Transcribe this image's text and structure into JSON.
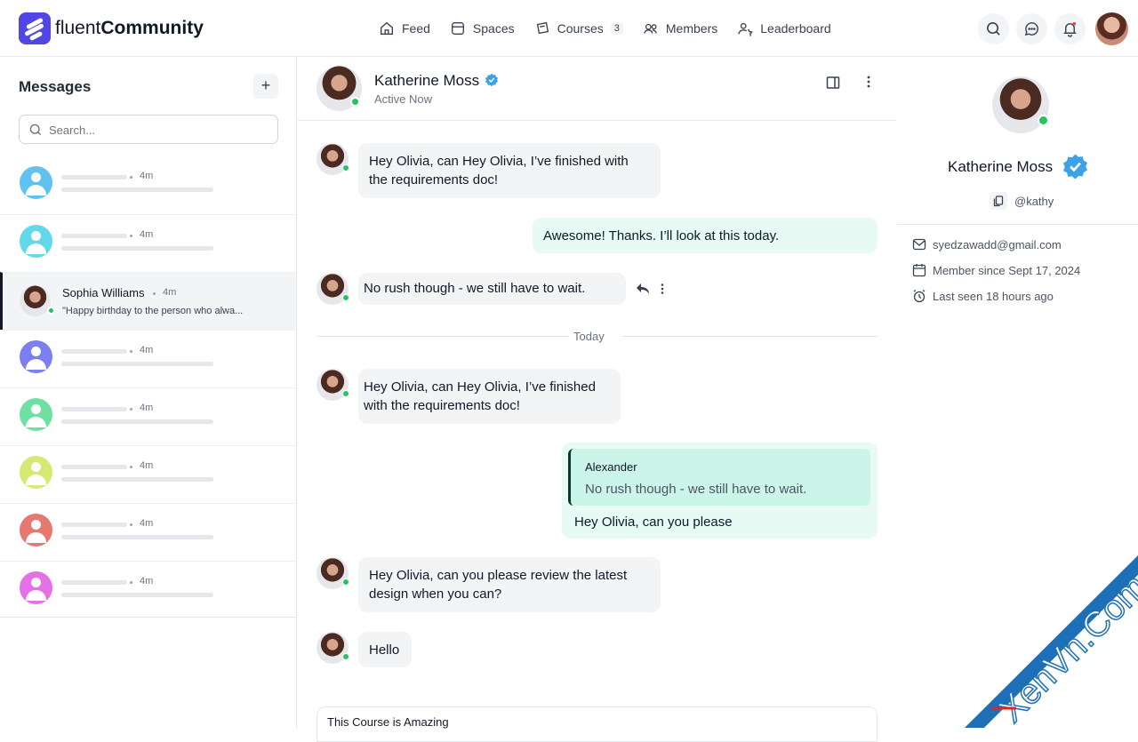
{
  "brand": {
    "name_light": "fluent",
    "name_bold": "Community"
  },
  "nav": [
    {
      "label": "Feed",
      "icon": "home-icon"
    },
    {
      "label": "Spaces",
      "icon": "spaces-icon"
    },
    {
      "label": "Courses",
      "icon": "courses-icon",
      "badge": "3"
    },
    {
      "label": "Members",
      "icon": "members-icon"
    },
    {
      "label": "Leaderboard",
      "icon": "leaderboard-icon"
    }
  ],
  "messages_panel": {
    "title": "Messages",
    "add_label": "+",
    "search_placeholder": "Search...",
    "conversations": [
      {
        "time": "4m",
        "avatar_color": "#5fc2ef"
      },
      {
        "time": "4m",
        "avatar_color": "#62d8e8"
      },
      {
        "name": "Sophia Williams",
        "time": "4m",
        "preview": "\"Happy birthday to the person who alwa...",
        "active": true
      },
      {
        "time": "4m",
        "avatar_color": "#7b7ff0"
      },
      {
        "time": "4m",
        "avatar_color": "#6ee1a1"
      },
      {
        "time": "4m",
        "avatar_color": "#d5ea72"
      },
      {
        "time": "4m",
        "avatar_color": "#e7786f"
      },
      {
        "time": "4m",
        "avatar_color": "#e571e6"
      }
    ]
  },
  "chat": {
    "name": "Katherine Moss",
    "status": "Active Now",
    "messages": [
      {
        "text": "Hey Olivia, can Hey Olivia, I’ve finished with the requirements doc!"
      },
      {
        "text": "Awesome! Thanks. I’ll look at this today."
      },
      {
        "text": "No rush though - we still have to wait."
      },
      {
        "text": "Hey Olivia, can Hey Olivia, I’ve finished with the requirements doc!"
      },
      {
        "text": "Hey Olivia, can you please",
        "quote_author": "Alexander",
        "quote_text": "No rush though - we still have to wait."
      },
      {
        "text": "Hey Olivia, can you please review the latest design when you can?"
      },
      {
        "text": "Hello"
      }
    ],
    "divider": "Today",
    "compose_text": "This Course is Amazing"
  },
  "profile": {
    "name": "Katherine Moss",
    "handle": "@kathy",
    "email": "syedzawadd@gmail.com",
    "member_since": "Member since Sept 17, 2024",
    "last_seen": "Last seen 18 hours ago"
  },
  "colors": {
    "brand": "#4f46e5",
    "verified": "#3aa3e8",
    "online": "#22c55e",
    "outgoing_bubble": "#e7faf4",
    "incoming_bubble": "#f3f4f6"
  },
  "watermark": {
    "text": "XenVn.Com",
    "color": "#1d6fb8"
  }
}
